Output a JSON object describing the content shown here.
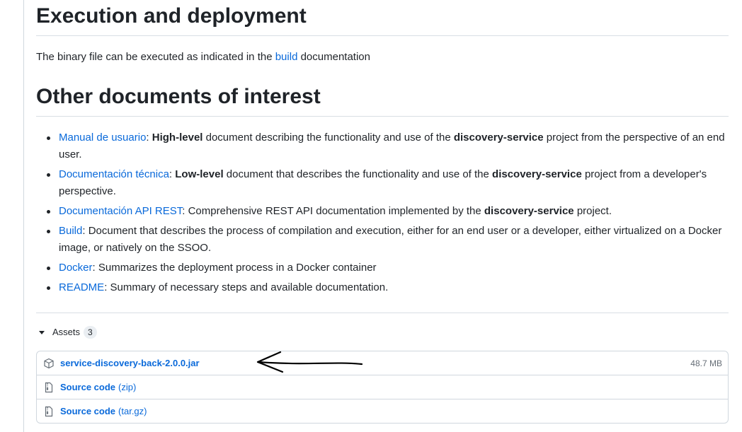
{
  "sections": {
    "execution_title": "Execution and deployment",
    "execution_text_before": "The binary file can be executed as indicated in the ",
    "execution_link": "build",
    "execution_text_after": " documentation",
    "other_title": "Other documents of interest"
  },
  "docs": [
    {
      "link": "Manual de usuario",
      "parts": [
        ": ",
        {
          "b": "High-level"
        },
        " document describing the functionality and use of the ",
        {
          "b": "discovery-service"
        },
        " project from the perspective of an end user."
      ]
    },
    {
      "link": "Documentación técnica",
      "parts": [
        ": ",
        {
          "b": "Low-level"
        },
        " document that describes the functionality and use of the ",
        {
          "b": "discovery-service"
        },
        " project from a developer's perspective."
      ]
    },
    {
      "link": "Documentación API REST",
      "parts": [
        ": Comprehensive REST API documentation implemented by the ",
        {
          "b": "discovery-service"
        },
        " project."
      ]
    },
    {
      "link": "Build",
      "parts": [
        ": Document that describes the process of compilation and execution, either for an end user or a developer, either virtualized on a Docker image, or natively on the SSOO."
      ]
    },
    {
      "link": "Docker",
      "parts": [
        ": Summarizes the deployment process in a Docker container"
      ]
    },
    {
      "link": "README",
      "parts": [
        ": Summary of necessary steps and available documentation."
      ]
    }
  ],
  "assets": {
    "label": "Assets",
    "count": "3",
    "items": [
      {
        "name": "service-discovery-back-2.0.0.jar",
        "sub": "",
        "size": "48.7 MB",
        "icon": "package-icon"
      },
      {
        "name": "Source code",
        "sub": "(zip)",
        "size": "",
        "icon": "file-zip-icon"
      },
      {
        "name": "Source code",
        "sub": "(tar.gz)",
        "size": "",
        "icon": "file-zip-icon"
      }
    ]
  }
}
